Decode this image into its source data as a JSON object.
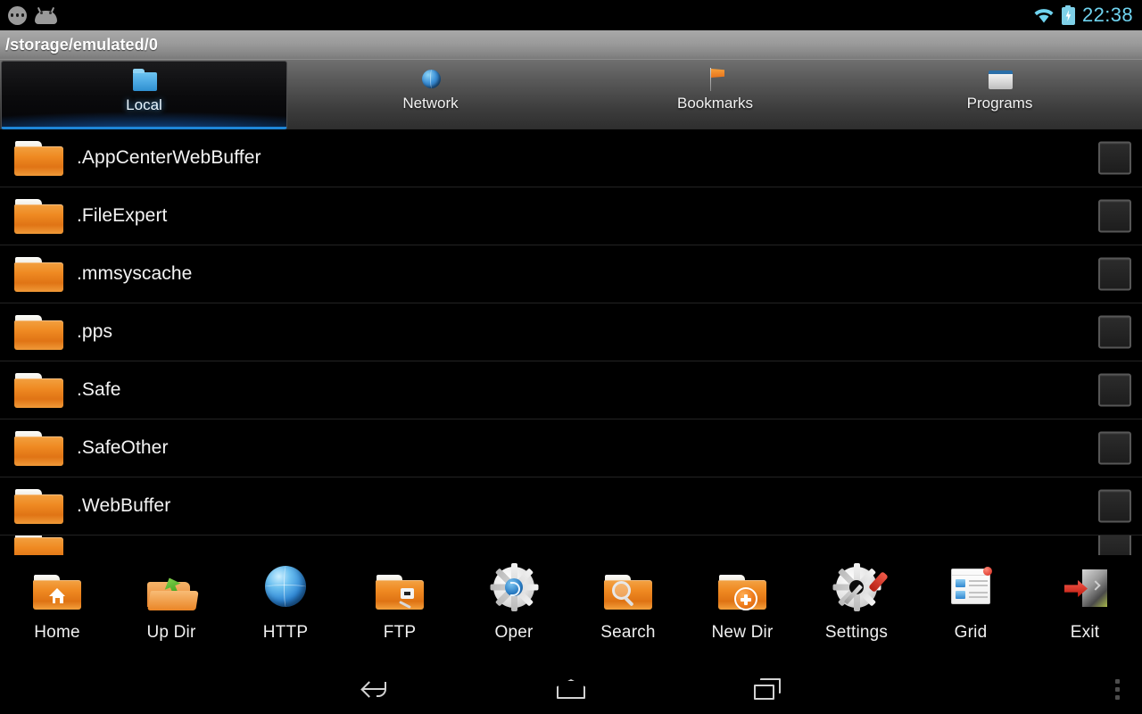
{
  "statusbar": {
    "notification_icons": [
      "messages-dots-icon",
      "android-head-icon"
    ],
    "wifi_icon": "wifi-icon",
    "battery_icon": "battery-charging-icon",
    "time": "22:38",
    "accent_color": "#6fd3ef"
  },
  "pathbar": {
    "path": "/storage/emulated/0"
  },
  "tabs": [
    {
      "label": "Local",
      "icon": "blue-folder-icon",
      "selected": true
    },
    {
      "label": "Network",
      "icon": "globe-icon",
      "selected": false
    },
    {
      "label": "Bookmarks",
      "icon": "flag-icon",
      "selected": false
    },
    {
      "label": "Programs",
      "icon": "grey-folder-icon",
      "selected": false
    }
  ],
  "selected_tab_highlight_color": "#1e86d8",
  "file_list": {
    "items": [
      {
        "name": ".AppCenterWebBuffer",
        "icon": "orange-folder-icon",
        "checked": false
      },
      {
        "name": ".FileExpert",
        "icon": "orange-folder-icon",
        "checked": false
      },
      {
        "name": ".mmsyscache",
        "icon": "orange-folder-icon",
        "checked": false
      },
      {
        "name": ".pps",
        "icon": "orange-folder-icon",
        "checked": false
      },
      {
        "name": ".Safe",
        "icon": "orange-folder-icon",
        "checked": false
      },
      {
        "name": ".SafeOther",
        "icon": "orange-folder-icon",
        "checked": false
      },
      {
        "name": ".WebBuffer",
        "icon": "orange-folder-icon",
        "checked": false
      }
    ]
  },
  "toolbar": {
    "items": [
      {
        "label": "Home",
        "icon": "folder-home-icon"
      },
      {
        "label": "Up Dir",
        "icon": "folder-up-arrow-icon"
      },
      {
        "label": "HTTP",
        "icon": "globe-icon"
      },
      {
        "label": "FTP",
        "icon": "folder-plug-icon"
      },
      {
        "label": "Oper",
        "icon": "gear-operations-icon"
      },
      {
        "label": "Search",
        "icon": "folder-search-icon"
      },
      {
        "label": "New Dir",
        "icon": "folder-plus-icon"
      },
      {
        "label": "Settings",
        "icon": "gear-screwdriver-icon"
      },
      {
        "label": "Grid",
        "icon": "grid-view-icon"
      },
      {
        "label": "Exit",
        "icon": "exit-door-icon"
      }
    ]
  },
  "navbar": {
    "back": "back-icon",
    "home": "home-icon",
    "recents": "recents-icon",
    "overflow": "overflow-menu-icon"
  }
}
